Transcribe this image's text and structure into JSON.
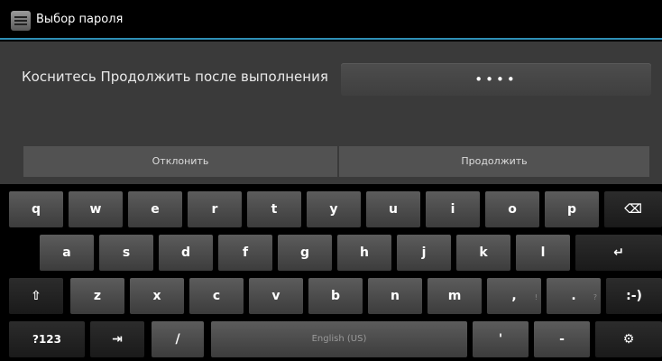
{
  "titlebar": {
    "title": "Выбор пароля",
    "icon": "settings-app-icon"
  },
  "content": {
    "prompt": "Коснитесь Продолжить после выполнения",
    "password_masked": "••••",
    "reject_label": "Отклонить",
    "continue_label": "Продолжить"
  },
  "keyboard": {
    "row1": [
      "q",
      "w",
      "e",
      "r",
      "t",
      "y",
      "u",
      "i",
      "o",
      "p"
    ],
    "backspace": "⌫",
    "row2": [
      "a",
      "s",
      "d",
      "f",
      "g",
      "h",
      "j",
      "k",
      "l"
    ],
    "enter": "↵",
    "shift": "⇧",
    "row3": [
      "z",
      "x",
      "c",
      "v",
      "b",
      "n",
      "m"
    ],
    "comma": ",",
    "comma_hint": "!",
    "period": ".",
    "period_hint": "?",
    "smiley": ":-)",
    "symbols": "?123",
    "tab": "⇥",
    "slash": "/",
    "space": "English (US)",
    "apostrophe": "'",
    "dash": "-",
    "settings": "⚙"
  }
}
